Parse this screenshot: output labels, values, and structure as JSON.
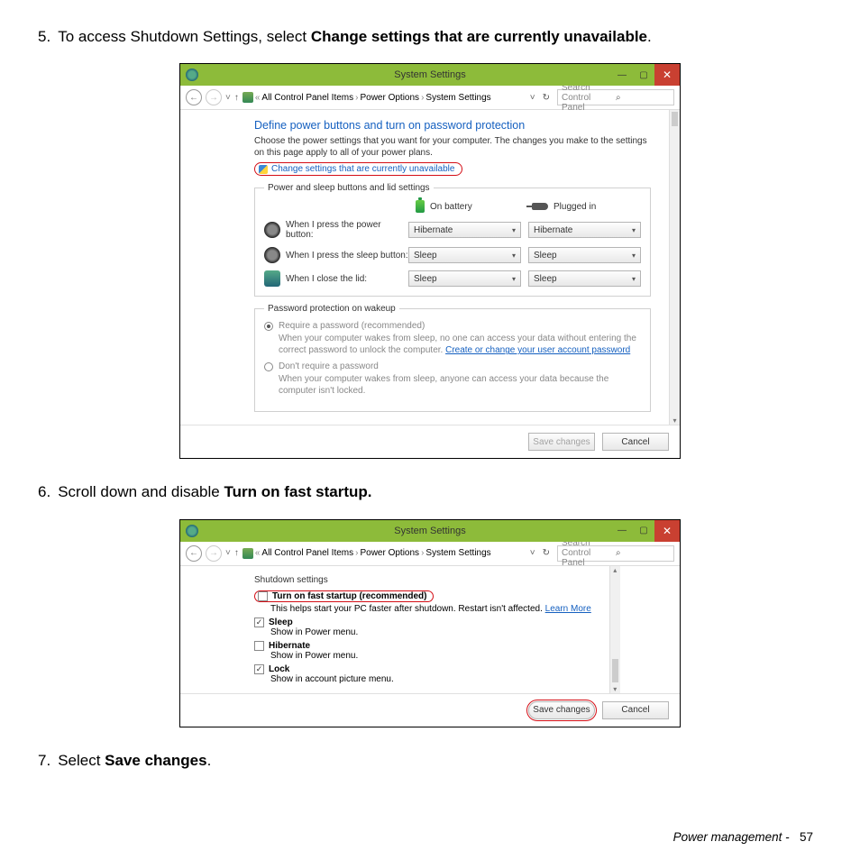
{
  "doc": {
    "step5_prefix": "To access Shutdown Settings, select ",
    "step5_bold": "Change settings that are currently unavailable",
    "step5_suffix": ".",
    "step6_prefix": "Scroll down and disable ",
    "step6_bold": "Turn on fast startup.",
    "step7_prefix": "Select ",
    "step7_bold": "Save changes",
    "step7_suffix": ".",
    "num5": "5.",
    "num6": "6.",
    "num7": "7.",
    "footer_label": "Power management -",
    "footer_page": "57"
  },
  "win": {
    "title": "System Settings",
    "min": "—",
    "max": "▢",
    "close": "✕",
    "back": "←",
    "fwd": "→",
    "up": "↑",
    "crumb_pre": "«",
    "crumb1": "All Control Panel Items",
    "crumb2": "Power Options",
    "crumb3": "System Settings",
    "crumb_sep": "›",
    "addr_caret": "˅",
    "refresh": "↻",
    "search_placeholder": "Search Control Panel"
  },
  "s1": {
    "heading": "Define power buttons and turn on password protection",
    "descr": "Choose the power settings that you want for your computer. The changes you make to the settings on this page apply to all of your power plans.",
    "change_link": "Change settings that are currently unavailable",
    "fs1_legend": "Power and sleep buttons and lid settings",
    "col_bat": "On battery",
    "col_plug": "Plugged in",
    "row_power": "When I press the power button:",
    "row_sleep": "When I press the sleep button:",
    "row_lid": "When I close the lid:",
    "val_hib": "Hibernate",
    "val_sleep": "Sleep",
    "fs2_legend": "Password protection on wakeup",
    "opt1": "Require a password (recommended)",
    "opt1_text_a": "When your computer wakes from sleep, no one can access your data without entering the correct password to unlock the computer. ",
    "opt1_link": "Create or change your user account password",
    "opt2": "Don't require a password",
    "opt2_text": "When your computer wakes from sleep, anyone can access your data because the computer isn't locked.",
    "save": "Save changes",
    "cancel": "Cancel"
  },
  "s2": {
    "section": "Shutdown settings",
    "cb1": "Turn on fast startup (recommended)",
    "cb1_sub_a": "This helps start your PC faster after shutdown. Restart isn't affected. ",
    "cb1_link": "Learn More",
    "cb2": "Sleep",
    "cb2_sub": "Show in Power menu.",
    "cb3": "Hibernate",
    "cb3_sub": "Show in Power menu.",
    "cb4": "Lock",
    "cb4_sub": "Show in account picture menu.",
    "save": "Save changes",
    "cancel": "Cancel"
  }
}
